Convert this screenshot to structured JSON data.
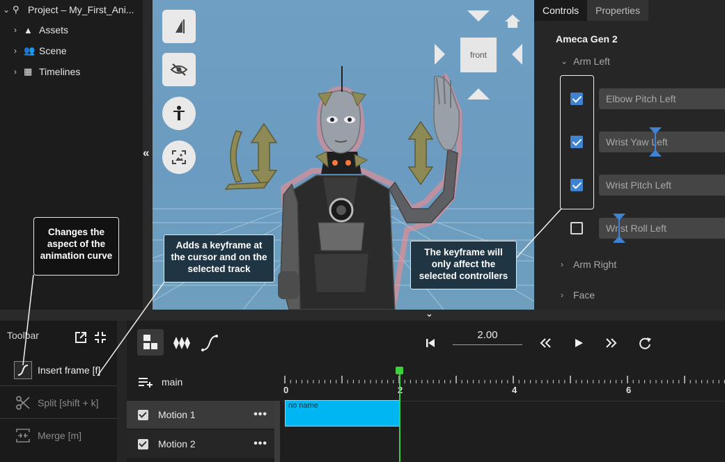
{
  "tree": {
    "project": "Project – My_First_Ani...",
    "items": [
      "Assets",
      "Scene",
      "Timelines"
    ]
  },
  "viewport": {
    "view_cube_label": "front"
  },
  "panel": {
    "tabs": [
      "Controls",
      "Properties"
    ],
    "model": "Ameca Gen 2",
    "group_open": "Arm Left",
    "controllers": [
      {
        "label": "Elbow Pitch Left",
        "checked": true
      },
      {
        "label": "Wrist Yaw Left",
        "checked": true
      },
      {
        "label": "Wrist Pitch Left",
        "checked": true
      },
      {
        "label": "Wrist Roll Left",
        "checked": false
      }
    ],
    "group_arm_right": "Arm Right",
    "group_face": "Face"
  },
  "callouts": {
    "curve": "Changes the aspect of the animation curve",
    "keyframe": "Adds a keyframe at the cursor and on the selected track",
    "selected": "The keyframe will only affect the selected controllers"
  },
  "toolbar": {
    "title": "Toolbar",
    "insert": "Insert frame [f]",
    "split": "Split [shift + k]",
    "merge": "Merge [m]"
  },
  "timeline": {
    "time_value": "2.00",
    "group": "main",
    "ticks": [
      "0",
      "2",
      "4",
      "6"
    ],
    "tracks": [
      "Motion 1",
      "Motion 2"
    ],
    "clip_label": "no name"
  },
  "colors": {
    "accent": "#3f82d0",
    "clip": "#00b6f2",
    "playhead": "#3ecf3e"
  }
}
